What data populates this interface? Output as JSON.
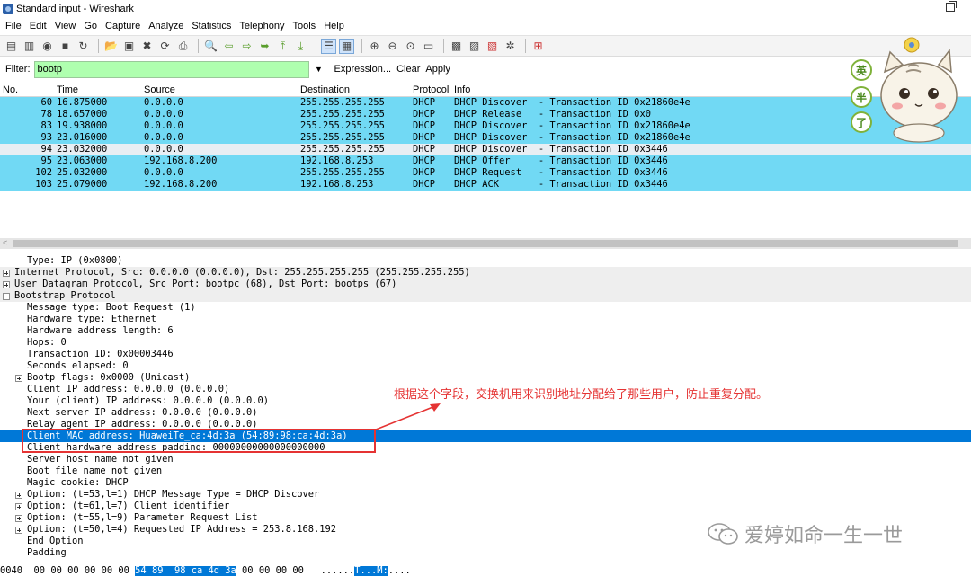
{
  "window": {
    "title": "Standard input - Wireshark"
  },
  "menu": [
    "File",
    "Edit",
    "View",
    "Go",
    "Capture",
    "Analyze",
    "Statistics",
    "Telephony",
    "Tools",
    "Help"
  ],
  "filter": {
    "label": "Filter:",
    "value": "bootp",
    "expression": "Expression...",
    "clear": "Clear",
    "apply": "Apply"
  },
  "packet_list": {
    "columns": [
      "No.",
      "Time",
      "Source",
      "Destination",
      "Protocol",
      "Info"
    ],
    "rows": [
      {
        "no": "60",
        "time": "16.875000",
        "src": "0.0.0.0",
        "dst": "255.255.255.255",
        "proto": "DHCP",
        "info": "DHCP Discover  - Transaction ID 0x21860e4e"
      },
      {
        "no": "78",
        "time": "18.657000",
        "src": "0.0.0.0",
        "dst": "255.255.255.255",
        "proto": "DHCP",
        "info": "DHCP Release   - Transaction ID 0x0"
      },
      {
        "no": "83",
        "time": "19.938000",
        "src": "0.0.0.0",
        "dst": "255.255.255.255",
        "proto": "DHCP",
        "info": "DHCP Discover  - Transaction ID 0x21860e4e"
      },
      {
        "no": "93",
        "time": "23.016000",
        "src": "0.0.0.0",
        "dst": "255.255.255.255",
        "proto": "DHCP",
        "info": "DHCP Discover  - Transaction ID 0x21860e4e"
      },
      {
        "no": "94",
        "time": "23.032000",
        "src": "0.0.0.0",
        "dst": "255.255.255.255",
        "proto": "DHCP",
        "info": "DHCP Discover  - Transaction ID 0x3446"
      },
      {
        "no": "95",
        "time": "23.063000",
        "src": "192.168.8.200",
        "dst": "192.168.8.253",
        "proto": "DHCP",
        "info": "DHCP Offer     - Transaction ID 0x3446"
      },
      {
        "no": "102",
        "time": "25.032000",
        "src": "0.0.0.0",
        "dst": "255.255.255.255",
        "proto": "DHCP",
        "info": "DHCP Request   - Transaction ID 0x3446"
      },
      {
        "no": "103",
        "time": "25.079000",
        "src": "192.168.8.200",
        "dst": "192.168.8.253",
        "proto": "DHCP",
        "info": "DHCP ACK       - Transaction ID 0x3446"
      }
    ]
  },
  "details": {
    "type_line": "Type: IP (0x0800)",
    "ip": "Internet Protocol, Src: 0.0.0.0 (0.0.0.0), Dst: 255.255.255.255 (255.255.255.255)",
    "udp": "User Datagram Protocol, Src Port: bootpc (68), Dst Port: bootps (67)",
    "bootp": "Bootstrap Protocol",
    "fields": [
      "Message type: Boot Request (1)",
      "Hardware type: Ethernet",
      "Hardware address length: 6",
      "Hops: 0",
      "Transaction ID: 0x00003446",
      "Seconds elapsed: 0",
      "Bootp flags: 0x0000 (Unicast)",
      "Client IP address: 0.0.0.0 (0.0.0.0)",
      "Your (client) IP address: 0.0.0.0 (0.0.0.0)",
      "Next server IP address: 0.0.0.0 (0.0.0.0)",
      "Relay agent IP address: 0.0.0.0 (0.0.0.0)",
      "Client MAC address: HuaweiTe_ca:4d:3a (54:89:98:ca:4d:3a)",
      "Client hardware address padding: 00000000000000000000",
      "Server host name not given",
      "Boot file name not given",
      "Magic cookie: DHCP",
      "Option: (t=53,l=1) DHCP Message Type = DHCP Discover",
      "Option: (t=61,l=7) Client identifier",
      "Option: (t=55,l=9) Parameter Request List",
      "Option: (t=50,l=4) Requested IP Address = 253.8.168.192",
      "End Option",
      "Padding"
    ]
  },
  "annotation": "根据这个字段，交换机用来识别地址分配给了那些用户，防止重复分配。",
  "hex": {
    "offset": "0040",
    "pre": "00 00 00 00 00 00",
    "sel": "54 89  98 ca 4d 3a",
    "post": "00 00 00 00",
    "ascii_pre": "......",
    "ascii_sel": "T...M:",
    "ascii_post": "...."
  },
  "watermark": "爱婷如命一生一世",
  "sticker": {
    "chars": [
      "英",
      "半",
      "了"
    ]
  },
  "colors": {
    "highlight_row": "#71d9f4",
    "selected": "#0078d7",
    "filter_ok": "#afffaf",
    "annotation": "#e53333"
  }
}
